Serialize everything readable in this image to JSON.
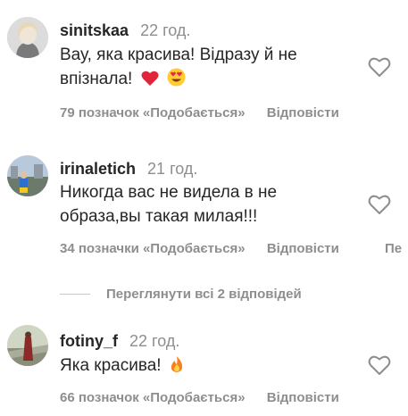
{
  "comments": [
    {
      "username": "sinitskaa",
      "time": "22 год.",
      "text_line1": "Вау, яка красива! Відразу й не",
      "text_line2": "впізнала!",
      "likes": "79 позначок «Подобається»",
      "reply": "Відповісти",
      "icons": [
        "red-heart-emoji",
        "heart-eyes-emoji"
      ]
    },
    {
      "username": "irinaletich",
      "time": "21 год.",
      "text_line1": "Никогда вас не видела в не",
      "text_line2": "образа,вы такая милая!!!",
      "likes": "34 позначки «Подобається»",
      "reply": "Відповісти",
      "extra": "Пе"
    },
    {
      "username": "fotiny_f",
      "time": "22 год.",
      "text_line1": "Яка красива!",
      "likes": "66 позначок «Подобається»",
      "reply": "Відповісти",
      "icons": [
        "fire-emoji"
      ]
    }
  ],
  "view_replies": "Переглянути всі 2 відповідей",
  "colors": {
    "text": "#262626",
    "secondary": "#8e8e8e",
    "divider": "#c7c7c7"
  }
}
